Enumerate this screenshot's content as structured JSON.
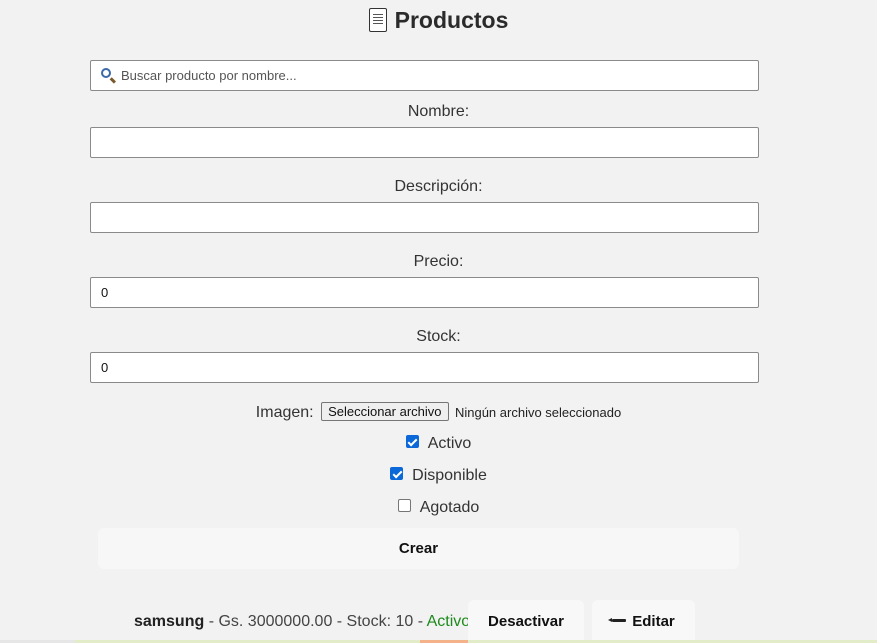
{
  "header": {
    "icon": "document-icon",
    "title": "Productos"
  },
  "search": {
    "icon": "search-icon",
    "placeholder": "Buscar producto por nombre...",
    "value": ""
  },
  "form": {
    "nombre": {
      "label": "Nombre:",
      "value": ""
    },
    "descripcion": {
      "label": "Descripción:",
      "value": ""
    },
    "precio": {
      "label": "Precio:",
      "value": "0"
    },
    "stock": {
      "label": "Stock:",
      "value": "0"
    },
    "imagen": {
      "label": "Imagen:",
      "button_label": "Seleccionar archivo",
      "status": "Ningún archivo seleccionado"
    },
    "checkboxes": [
      {
        "label": "Activo",
        "checked": true
      },
      {
        "label": "Disponible",
        "checked": true
      },
      {
        "label": "Agotado",
        "checked": false
      }
    ],
    "submit_label": "Crear"
  },
  "products": [
    {
      "name": "samsung",
      "details": " - Gs. 3000000.00 - Stock: 10 - ",
      "status": "Activo",
      "status_color": "#1e8a1e",
      "deactivate_label": "Desactivar",
      "edit_label": "Editar",
      "edit_icon": "pencil-icon"
    }
  ],
  "colors": {
    "background": "#f2f2f2",
    "checkbox_checked": "#0b68d8"
  }
}
